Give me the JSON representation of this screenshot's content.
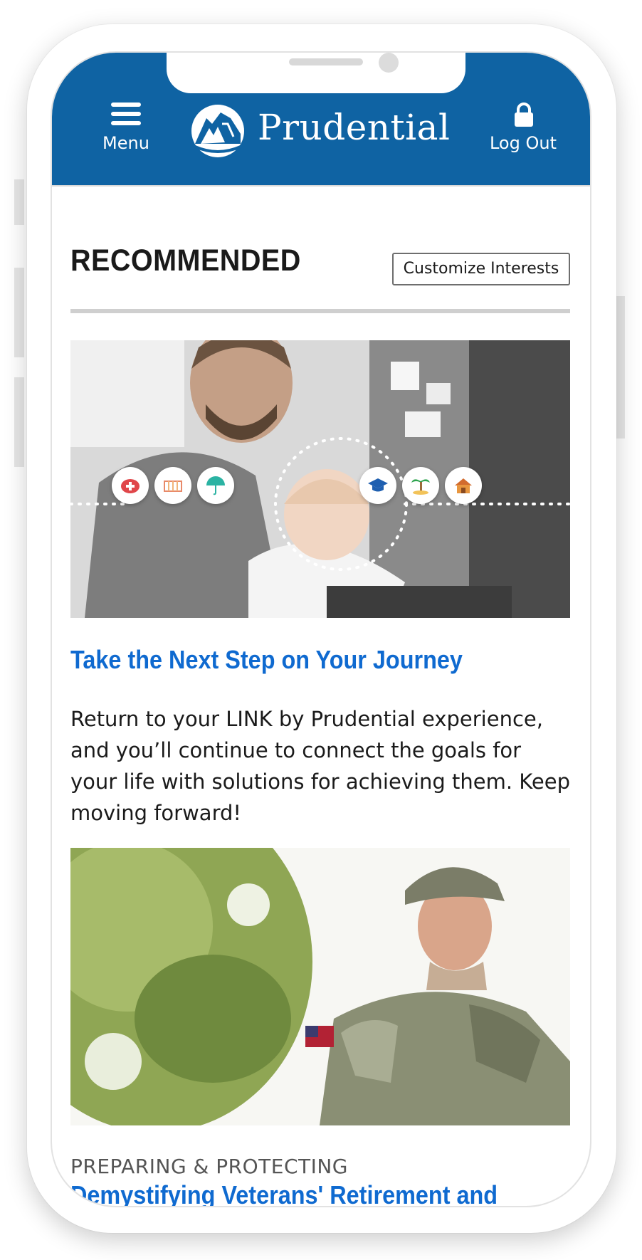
{
  "header": {
    "menu_label": "Menu",
    "logo_text": "Prudential",
    "logout_label": "Log Out",
    "brand_color": "#0f63a3"
  },
  "recommended": {
    "title": "RECOMMENDED",
    "customize_label": "Customize Interests"
  },
  "cards": [
    {
      "image": "father-and-baby-at-laptop-photo",
      "title": "Take the Next Step on Your Journey",
      "body": "Return to your LINK by Prudential experience, and you’ll continue to connect the goals for your life with solutions for achieving them. Keep moving forward!"
    },
    {
      "image": "smiling-soldier-photo",
      "eyebrow": "PREPARING & PROTECTING",
      "title": "Demystifying Veterans' Retirement and Medical Benefits"
    }
  ],
  "journey_icons": [
    "piggy-bank-icon",
    "crib-icon",
    "umbrella-icon",
    "graduation-cap-icon",
    "palm-tree-icon",
    "house-icon"
  ],
  "colors": {
    "link_blue": "#0f6ad0",
    "divider": "#cfcfcf"
  }
}
